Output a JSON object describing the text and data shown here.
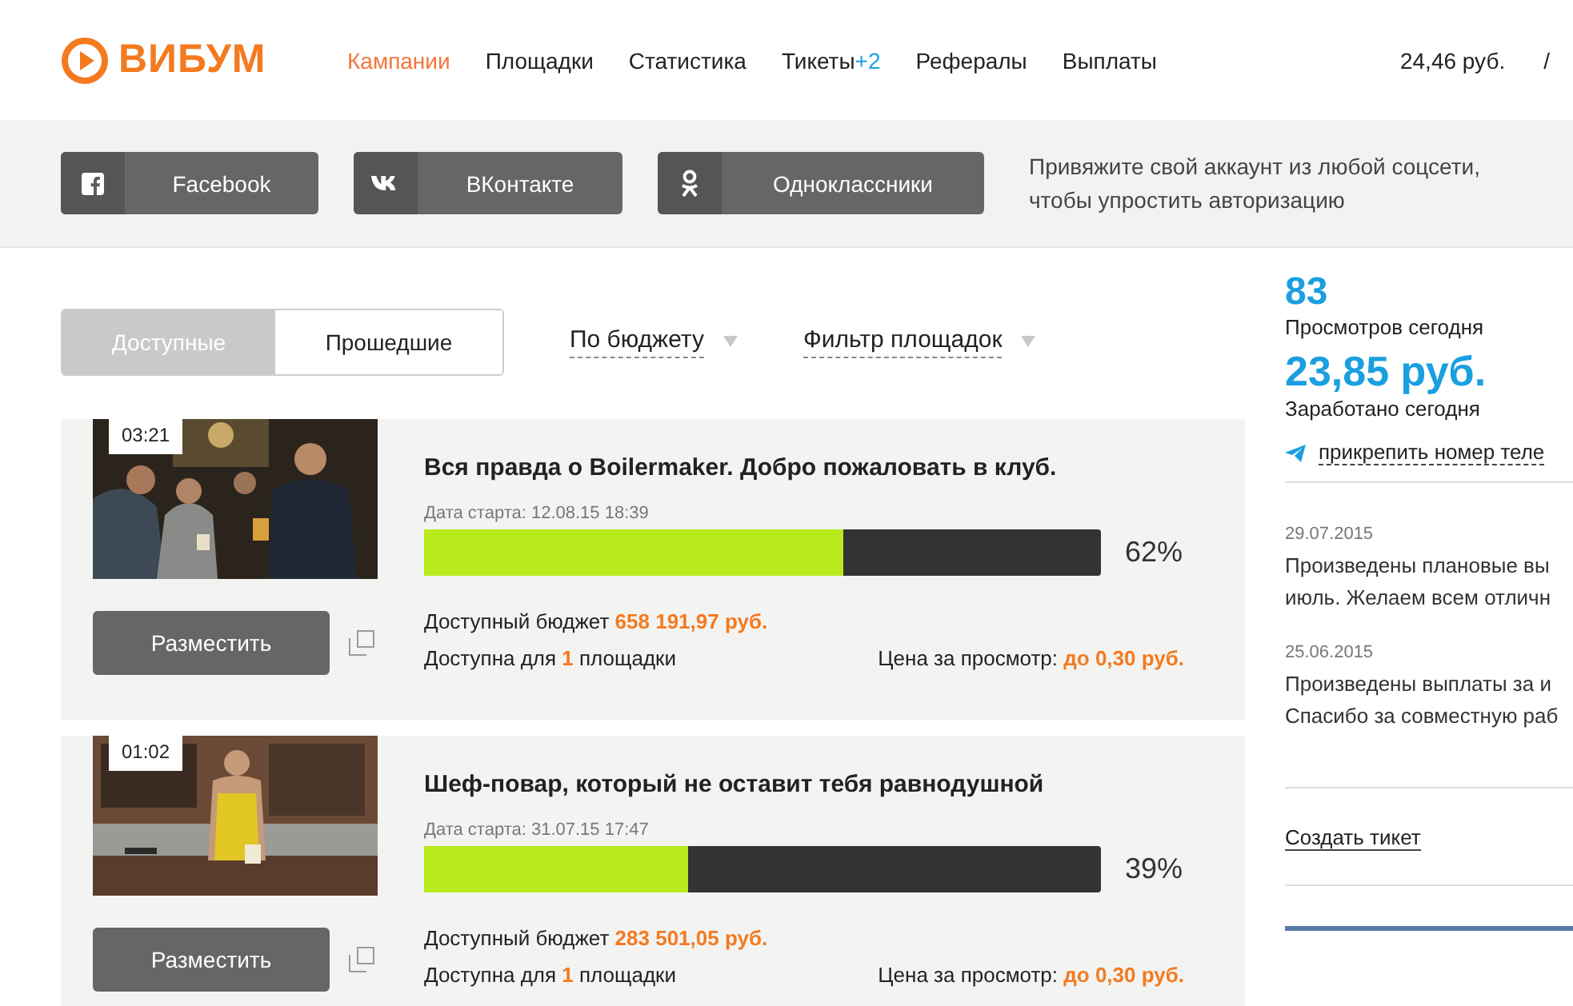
{
  "header": {
    "logo": "ВИБУМ",
    "nav": [
      {
        "label": "Кампании",
        "selected": true
      },
      {
        "label": "Площадки",
        "selected": false
      },
      {
        "label": "Статистика",
        "selected": false
      },
      {
        "label": "Тикеты",
        "badge": "+2",
        "selected": false
      },
      {
        "label": "Рефералы",
        "selected": false
      },
      {
        "label": "Выплаты",
        "selected": false
      }
    ],
    "balance": "24,46 руб.",
    "separator": "/"
  },
  "social": {
    "buttons": [
      {
        "kind": "facebook",
        "label": "Facebook"
      },
      {
        "kind": "vk",
        "label": "ВКонтакте"
      },
      {
        "kind": "ok",
        "label": "Одноклассники"
      }
    ],
    "hint": "Привяжите свой аккаунт из любой соцсети, чтобы упростить авторизацию"
  },
  "filters": {
    "tabs": [
      {
        "label": "Доступные",
        "selected": true
      },
      {
        "label": "Прошедшие",
        "selected": false
      }
    ],
    "dropdowns": [
      "По бюджету",
      "Фильтр площадок"
    ]
  },
  "campaigns": [
    {
      "duration": "03:21",
      "title": "Вся правда о Boilermaker. Добро пожаловать в клуб.",
      "start": "Дата старта: 12.08.15 18:39",
      "level": 0.62,
      "percent": "62%",
      "button": "Разместить",
      "budget_label": "Доступный бюджет",
      "budget": "658 191,97 руб.",
      "avail_prefix": "Доступна для",
      "avail_count": "1",
      "avail_suffix": "площадки",
      "price_label": "Цена за просмотр:",
      "price": "до 0,30 руб."
    },
    {
      "duration": "01:02",
      "title": "Шеф-повар, который не оставит тебя равнодушной",
      "start": "Дата старта: 31.07.15 17:47",
      "level": 0.39,
      "percent": "39%",
      "button": "Разместить",
      "budget_label": "Доступный бюджет",
      "budget": "283 501,05 руб.",
      "avail_prefix": "Доступна для",
      "avail_count": "1",
      "avail_suffix": "площадки",
      "price_label": "Цена за просмотр:",
      "price": "до 0,30 руб."
    }
  ],
  "sidebar": {
    "stats": [
      {
        "value": "83",
        "label": "Просмотров сегодня"
      },
      {
        "value": "23,85 руб.",
        "label": "Заработано сегодня"
      }
    ],
    "telegram_link": "прикрепить номер теле",
    "news": [
      {
        "date": "29.07.2015",
        "lines": [
          "Произведены плановые вы",
          "июль. Желаем всем отличн"
        ]
      },
      {
        "date": "25.06.2015",
        "lines": [
          "Произведены выплаты за и",
          "Спасибо за совместную раб"
        ]
      }
    ],
    "ticket_link": "Создать тикет"
  }
}
